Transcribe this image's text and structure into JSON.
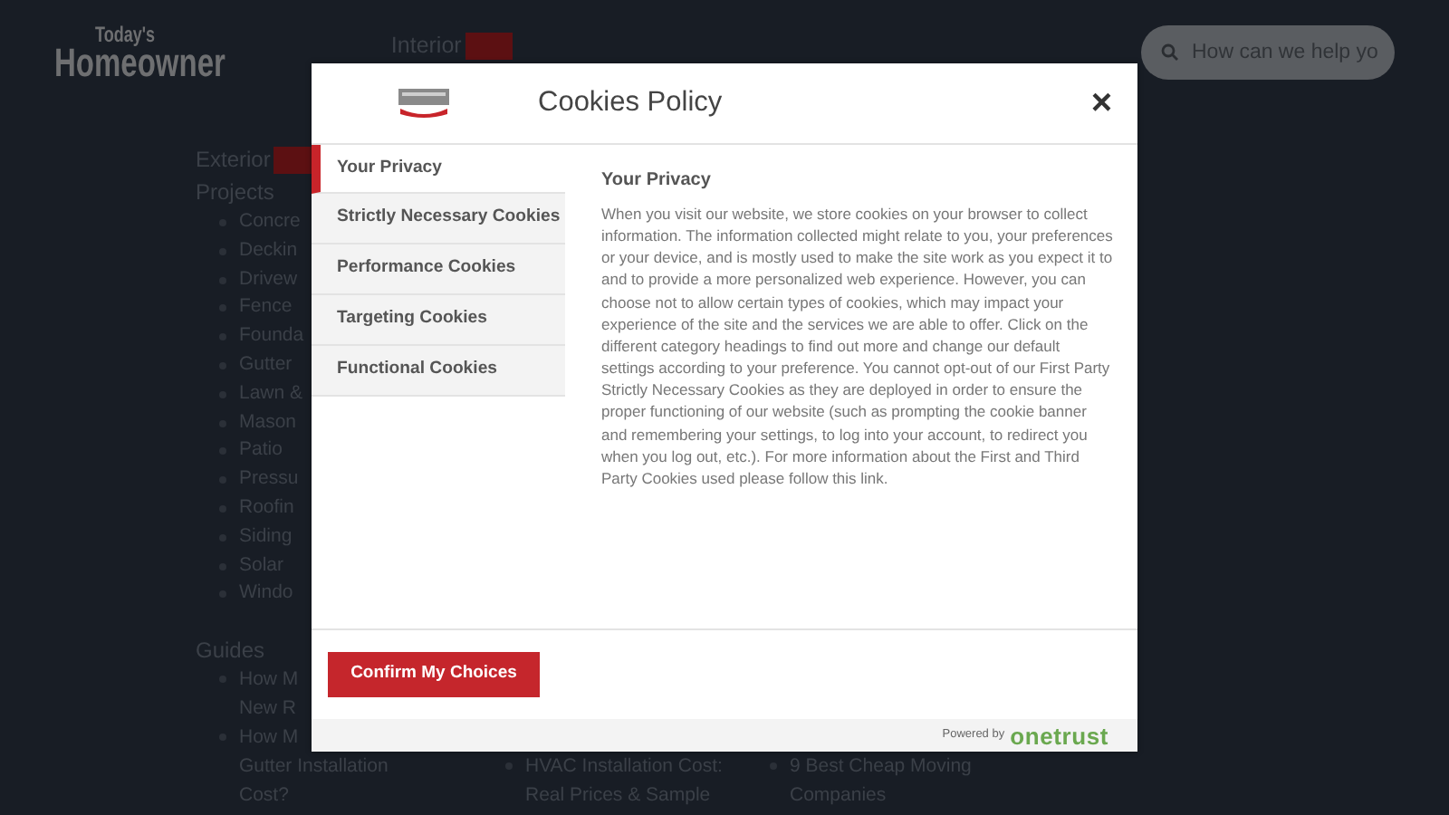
{
  "site": {
    "logo_top": "Today's",
    "logo_bottom": "Homeowner",
    "nav": [
      {
        "label": "Interior"
      }
    ],
    "search": {
      "placeholder": "How can we help yo"
    },
    "sections": [
      {
        "heading": "Exterior",
        "title": "Projects",
        "items": [
          [
            "Concre"
          ],
          [
            "Deckin"
          ],
          [
            "Drivew"
          ],
          [
            "Fence"
          ],
          [
            "Founda"
          ],
          [
            "Gutter"
          ],
          [
            "Lawn &"
          ],
          [
            "Mason"
          ],
          [
            "Patio"
          ],
          [
            "Pressu"
          ],
          [
            "Roofin"
          ],
          [
            "Siding"
          ],
          [
            "Solar"
          ],
          [
            "Windo"
          ]
        ]
      }
    ],
    "guides": {
      "title": "Guides",
      "columns": [
        [
          [
            "How M",
            "New R"
          ],
          [
            "How M",
            "Gutter Installation",
            "Cost?"
          ]
        ],
        [
          [
            "HVAC Installation Cost:",
            "Real Prices & Sample"
          ]
        ],
        [
          [
            "9 Best Cheap Moving",
            "Companies"
          ]
        ]
      ]
    }
  },
  "dialog": {
    "title": "Cookies Policy",
    "close": "×",
    "tabs": [
      {
        "label": "Your Privacy",
        "selected": true
      },
      {
        "label": "Strictly Necessary Cookies",
        "selected": false
      },
      {
        "label": "Performance Cookies",
        "selected": false
      },
      {
        "label": "Targeting Cookies",
        "selected": false
      },
      {
        "label": "Functional Cookies",
        "selected": false
      }
    ],
    "content_title": "Your Privacy",
    "content_text": "When you visit our website, we store cookies on your browser to collect information. The information collected might relate to you, your preferences or your device, and is mostly used to make the site work as you expect it to and to provide a more personalized web experience. However, you can choose not to allow certain types of cookies, which may impact your experience of the site and the services we are able to offer. Click on the different category headings to find out more and change our default settings according to your preference. You cannot opt-out of our First Party Strictly Necessary Cookies as they are deployed in order to ensure the proper functioning of our website (such as prompting the cookie banner and remembering your settings, to log into your account, to redirect you when you log out, etc.). For more information about the First and Third Party Cookies used please follow this link.",
    "confirm": "Confirm My Choices",
    "powered_by": "Powered by",
    "brand": "onetrust"
  }
}
